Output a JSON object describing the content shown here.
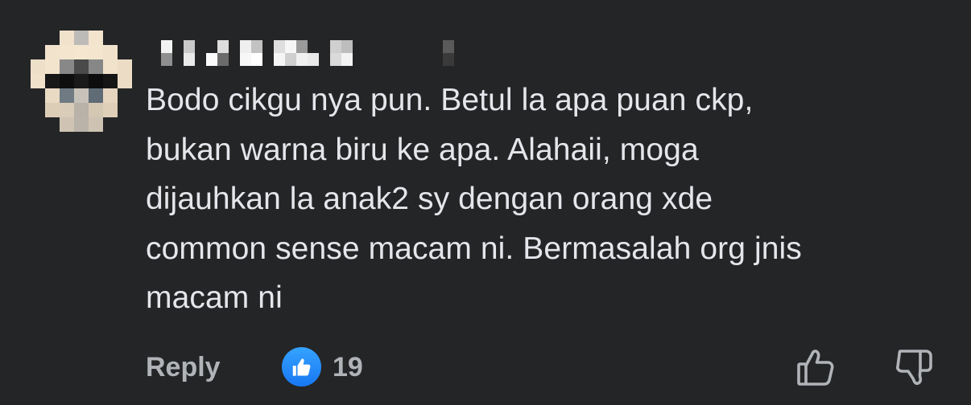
{
  "comment": {
    "author": "",
    "text": "Bodo cikgu nya pun. Betul la apa puan ckp,\nbukan warna biru ke apa. Alahaii, moga\ndijauhkan la anak2 sy dengan orang xde\ncommon sense macam ni. Bermasalah org jnis\nmacam ni"
  },
  "actions": {
    "reply_label": "Reply",
    "like_count": "19"
  },
  "icons": {
    "like_badge": "thumbs-up-icon",
    "upvote": "thumb-up-outline-icon",
    "downvote": "thumb-down-outline-icon"
  },
  "colors": {
    "background": "#242526",
    "text": "#e4e6eb",
    "secondary_text": "#b0b3b8",
    "like_blue": "#1877f2"
  }
}
